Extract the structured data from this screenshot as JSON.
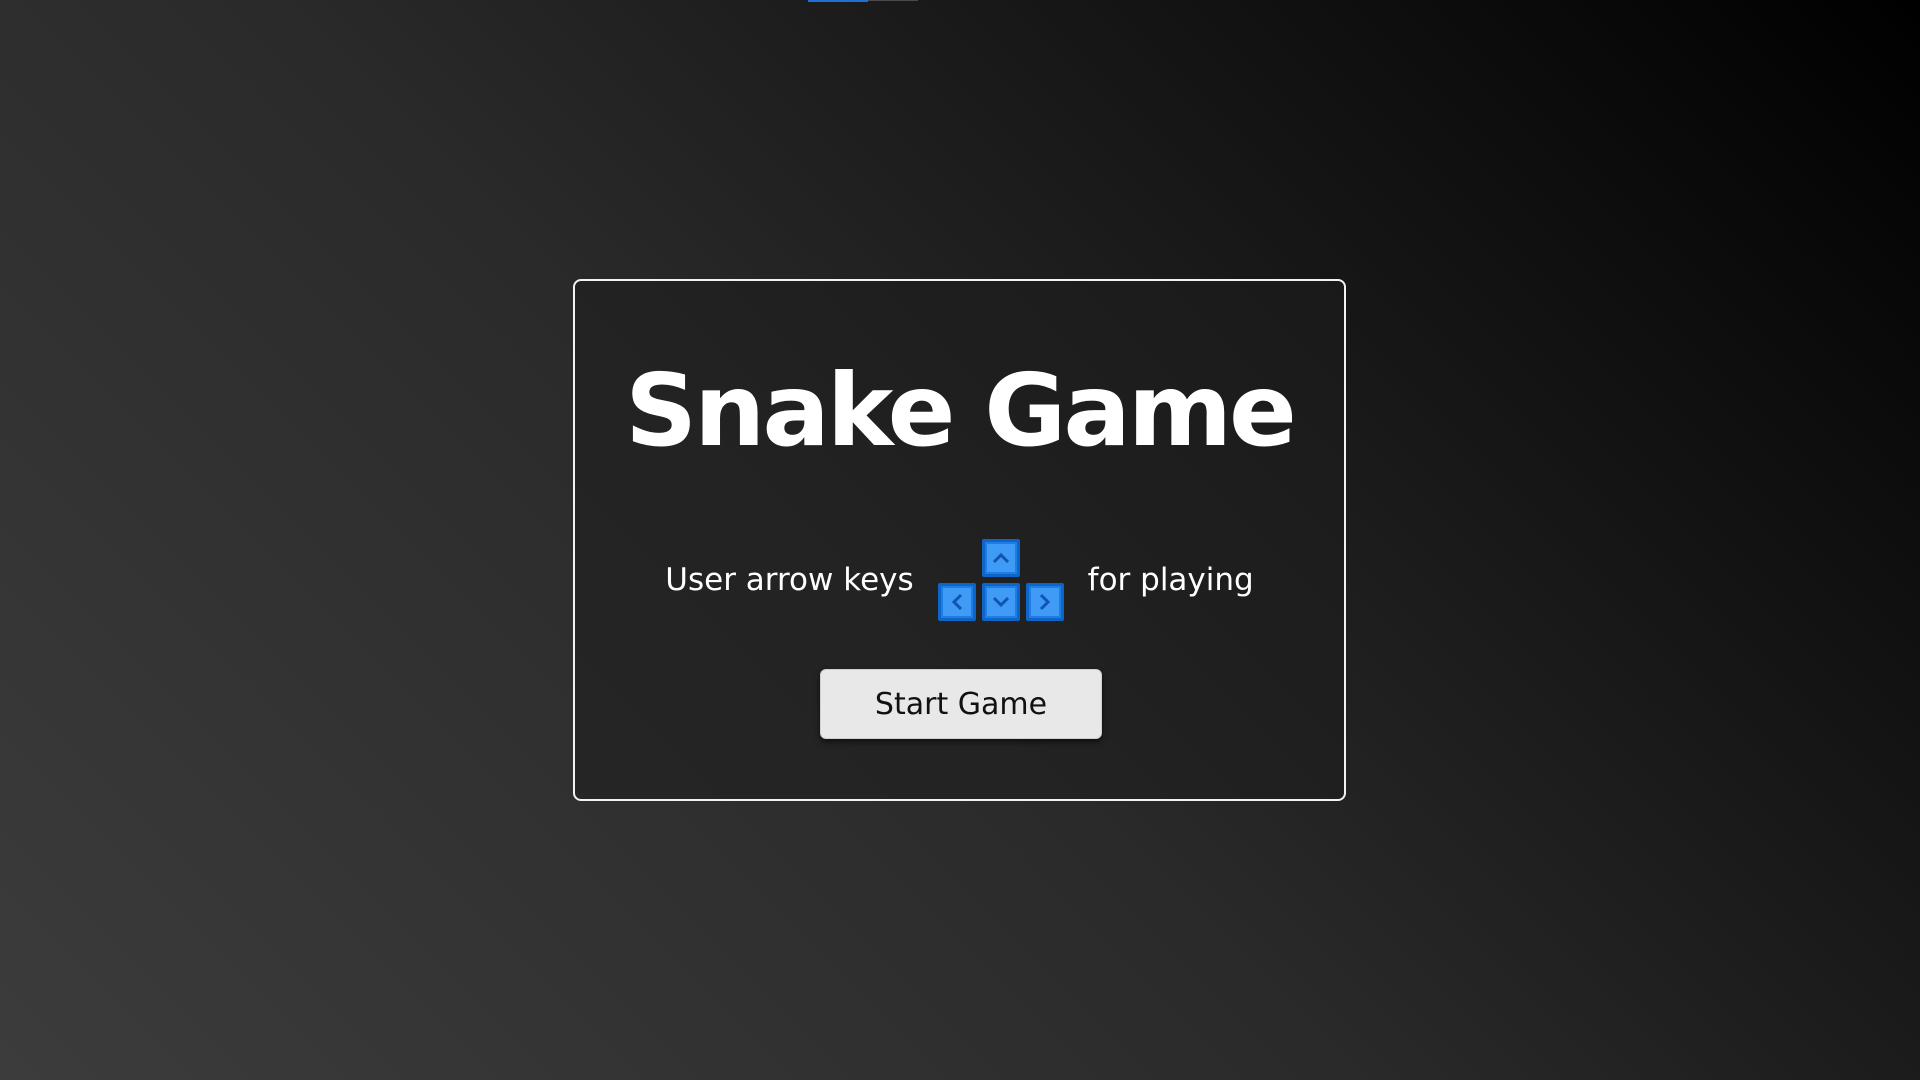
{
  "title": "Snake Game",
  "instructions": {
    "before": "User arrow keys",
    "after": "for playing"
  },
  "keys": {
    "up": "arrow-up-key-icon",
    "left": "arrow-left-key-icon",
    "down": "arrow-down-key-icon",
    "right": "arrow-right-key-icon"
  },
  "start_button_label": "Start Game",
  "colors": {
    "key_blue": "#1d7fe6",
    "key_inner": "#3f9bf5",
    "card_border": "#f2f2f2",
    "button_bg": "#e8e8e8"
  }
}
